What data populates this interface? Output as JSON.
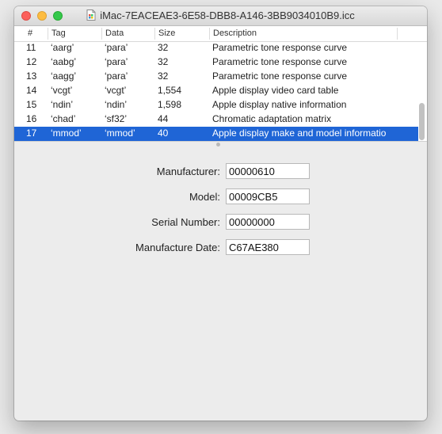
{
  "window": {
    "title": "iMac-7EACEAE3-6E58-DBB8-A146-3BB9034010B9.icc",
    "title_icon": "document-icon"
  },
  "table": {
    "columns": [
      "#",
      "Tag",
      "Data",
      "Size",
      "Description"
    ],
    "rows": [
      {
        "num": "11",
        "tag": "‘aarg’",
        "data": "‘para’",
        "size": "32",
        "desc": "Parametric tone response curve"
      },
      {
        "num": "12",
        "tag": "‘aabg’",
        "data": "‘para’",
        "size": "32",
        "desc": "Parametric tone response curve"
      },
      {
        "num": "13",
        "tag": "‘aagg’",
        "data": "‘para’",
        "size": "32",
        "desc": "Parametric tone response curve"
      },
      {
        "num": "14",
        "tag": "‘vcgt’",
        "data": "‘vcgt’",
        "size": "1,554",
        "desc": "Apple display video card table"
      },
      {
        "num": "15",
        "tag": "‘ndin’",
        "data": "‘ndin’",
        "size": "1,598",
        "desc": "Apple display native information"
      },
      {
        "num": "16",
        "tag": "‘chad’",
        "data": "‘sf32’",
        "size": "44",
        "desc": "Chromatic adaptation matrix"
      },
      {
        "num": "17",
        "tag": "‘mmod’",
        "data": "‘mmod’",
        "size": "40",
        "desc": "Apple display make and model informatio"
      }
    ],
    "selected_row": "17",
    "selection_color": "#1f65d6"
  },
  "details": {
    "manufacturer": {
      "label": "Manufacturer:",
      "value": "00000610"
    },
    "model": {
      "label": "Model:",
      "value": "00009CB5"
    },
    "serial": {
      "label": "Serial Number:",
      "value": "00000000"
    },
    "date": {
      "label": "Manufacture Date:",
      "value": "C67AE380"
    }
  }
}
